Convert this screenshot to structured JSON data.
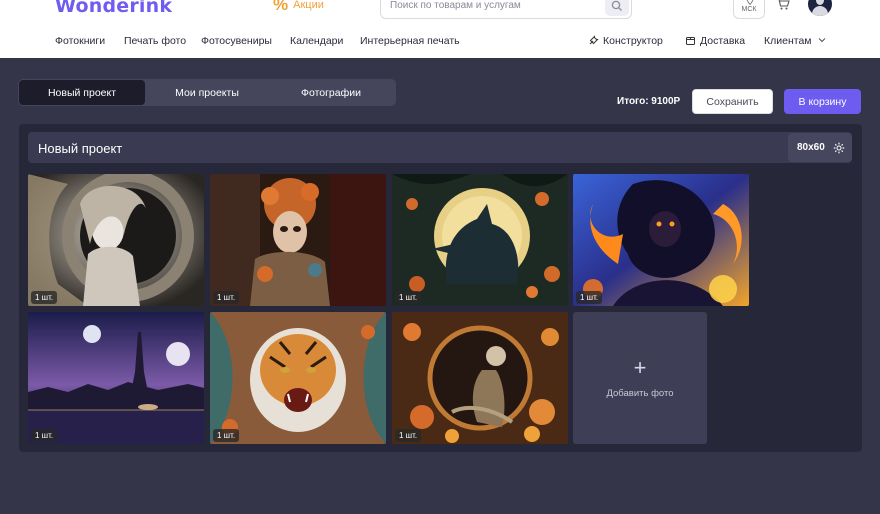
{
  "header": {
    "logo": "Wonderink",
    "promo_label": "Акции",
    "search_placeholder": "Поиск по товарам и услугам",
    "city": "МСК"
  },
  "nav": {
    "items": [
      "Фотокниги",
      "Печать фото",
      "Фотосувениры",
      "Календари",
      "Интерьерная печать"
    ],
    "constructor": "Конструктор",
    "delivery": "Доставка",
    "clients": "Клиентам"
  },
  "tabs": [
    "Новый проект",
    "Мои проекты",
    "Фотографии"
  ],
  "active_tab": "Новый проект",
  "toolbar": {
    "total": "Итого: 9100Р",
    "save_label": "Сохранить",
    "cart_label": "В корзину"
  },
  "project": {
    "title": "Новый проект",
    "size": "80x60",
    "photos": [
      {
        "name": "gothic-woman",
        "qty": "1 шт."
      },
      {
        "name": "floral-mask-woman",
        "qty": "1 шт."
      },
      {
        "name": "wolf-moon",
        "qty": "1 шт."
      },
      {
        "name": "fire-demon-girl",
        "qty": "1 шт."
      },
      {
        "name": "paris-night",
        "qty": "1 шт."
      },
      {
        "name": "tiger-paper-art",
        "qty": "1 шт."
      },
      {
        "name": "skeleton-flowers",
        "qty": "1 шт."
      }
    ],
    "add_label": "Добавить фото"
  },
  "colors": {
    "accent": "#6e5cf0",
    "promo": "#f0a23a",
    "page_bg": "#35354a",
    "panel_bg": "#27273a"
  }
}
